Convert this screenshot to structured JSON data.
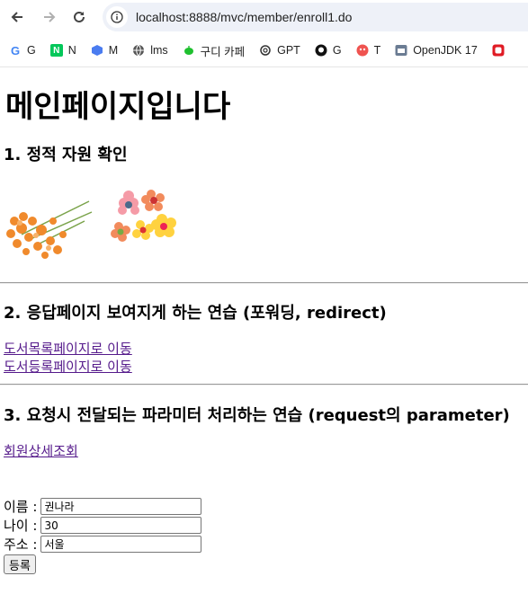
{
  "browser": {
    "url": "localhost:8888/mvc/member/enroll1.do",
    "bookmarks": [
      {
        "label": "G",
        "icon": "google-icon"
      },
      {
        "label": "N",
        "icon": "naver-icon"
      },
      {
        "label": "M",
        "icon": "hexagon-icon"
      },
      {
        "label": "lms",
        "icon": "globe-icon"
      },
      {
        "label": "구디 카페",
        "icon": "leaf-icon"
      },
      {
        "label": "GPT",
        "icon": "openai-icon"
      },
      {
        "label": "G",
        "icon": "github-icon"
      },
      {
        "label": "T",
        "icon": "red-dot-icon"
      },
      {
        "label": "OpenJDK 17",
        "icon": "java-icon"
      }
    ]
  },
  "page": {
    "title": "메인페이지입니다",
    "section1": {
      "heading": "1. 정적 자원 확인"
    },
    "section2": {
      "heading": "2. 응답페이지 보여지게 하는 연습 (포워딩, redirect)",
      "links": [
        "도서목록페이지로 이동",
        "도서등록페이지로 이동"
      ]
    },
    "section3": {
      "heading": "3. 요청시 전달되는 파라미터 처리하는 연습 (request의 parameter)",
      "link": "회원상세조회"
    },
    "form": {
      "name_label": "이름 :",
      "name_value": "권나라",
      "age_label": "나이 :",
      "age_value": "30",
      "address_label": "주소 :",
      "address_value": "서울",
      "submit_label": "등록"
    }
  }
}
